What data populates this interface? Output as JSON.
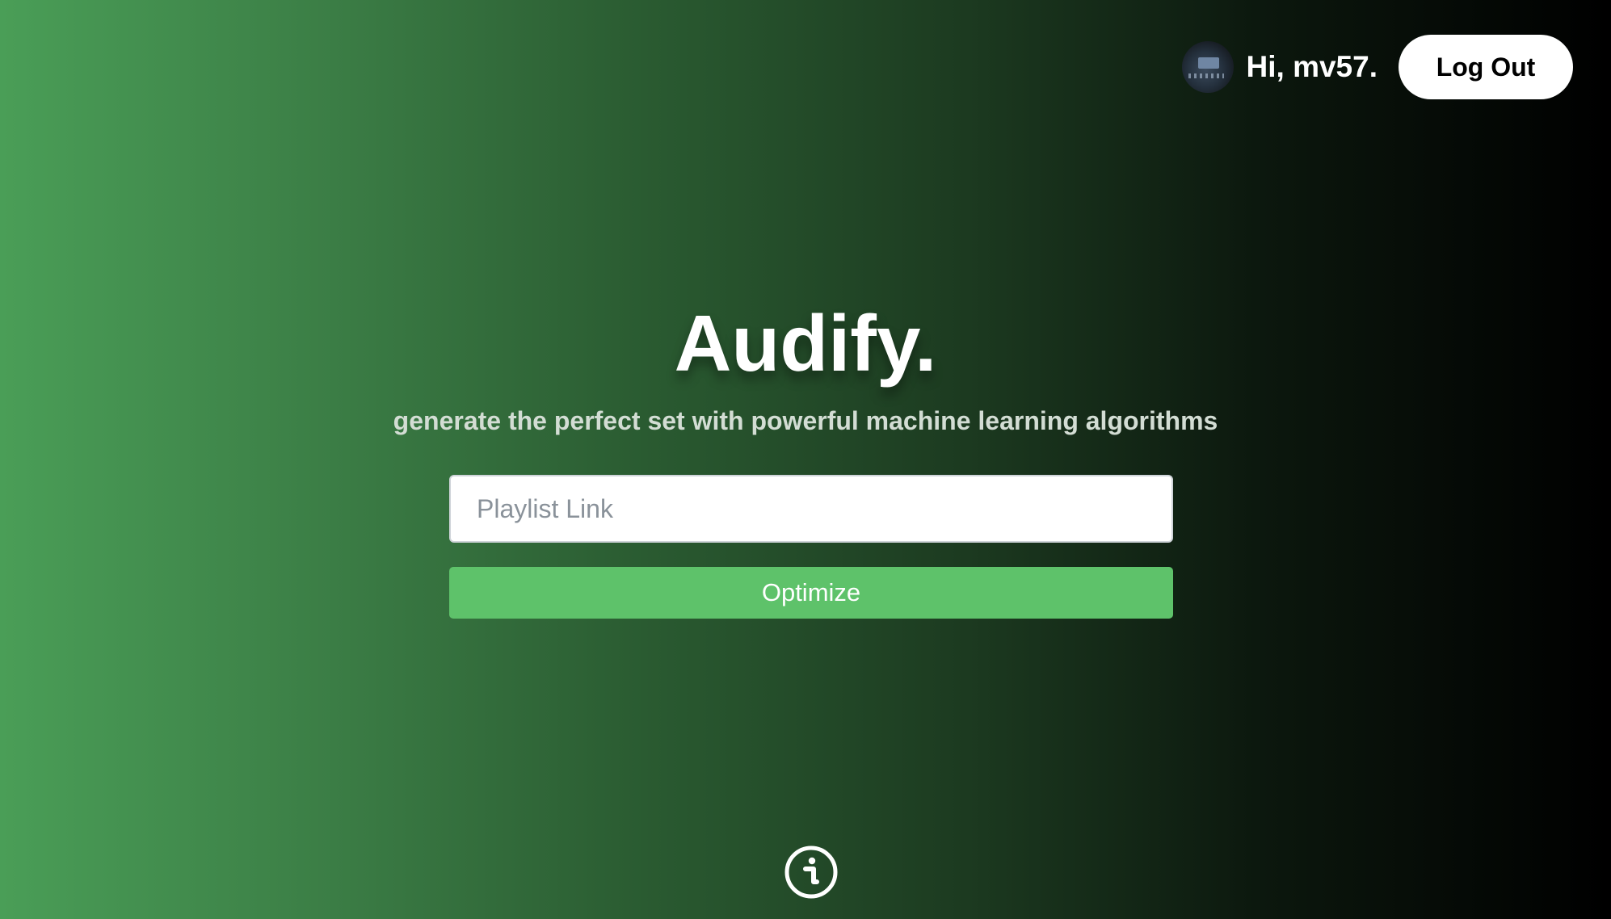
{
  "header": {
    "greeting": "Hi, mv57.",
    "logout_label": "Log Out",
    "avatar_icon": "user-avatar-photo"
  },
  "hero": {
    "title": "Audify.",
    "subtitle": "generate the perfect set with powerful machine learning algorithms"
  },
  "form": {
    "playlist_placeholder": "Playlist Link",
    "playlist_value": "",
    "optimize_label": "Optimize"
  },
  "footer": {
    "info_icon": "info-icon"
  },
  "colors": {
    "gradient_start": "#4a9e57",
    "gradient_end": "#000000",
    "accent": "#5ec26a",
    "button_bg": "#ffffff"
  }
}
